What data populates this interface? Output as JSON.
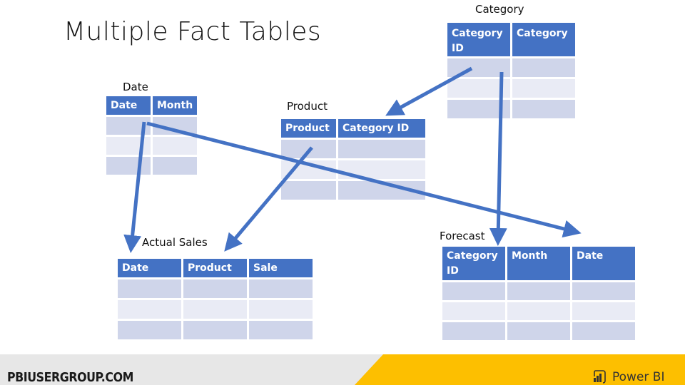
{
  "slide": {
    "title": "Multiple Fact Tables"
  },
  "tables": {
    "category": {
      "label": "Category",
      "columns": [
        "Category ID",
        "Category"
      ]
    },
    "date": {
      "label": "Date",
      "columns": [
        "Date",
        "Month"
      ]
    },
    "product": {
      "label": "Product",
      "columns": [
        "Product",
        "Category ID"
      ]
    },
    "actual_sales": {
      "label": "Actual Sales",
      "columns": [
        "Date",
        "Product",
        "Sale"
      ]
    },
    "forecast": {
      "label": "Forecast",
      "columns": [
        "Category ID",
        "Month",
        "Date"
      ]
    }
  },
  "relationships": [
    {
      "from": "category.Category ID",
      "to": "product.Category ID"
    },
    {
      "from": "category.Category ID",
      "to": "forecast.Category ID"
    },
    {
      "from": "date.Date",
      "to": "actual_sales.Date"
    },
    {
      "from": "date.Date",
      "to": "forecast.Date"
    },
    {
      "from": "product.Product",
      "to": "actual_sales.Product"
    }
  ],
  "footer": {
    "site": "PBIUSERGROUP.COM",
    "brand": "Power BI",
    "brand_icon": "power-bi-icon"
  },
  "colors": {
    "header": "#4472c4",
    "row_dark": "#cfd5ea",
    "row_light": "#e9ebf5",
    "arrow": "#4472c4",
    "footer_gray": "#e7e7e7",
    "footer_yellow": "#fdbf00"
  }
}
